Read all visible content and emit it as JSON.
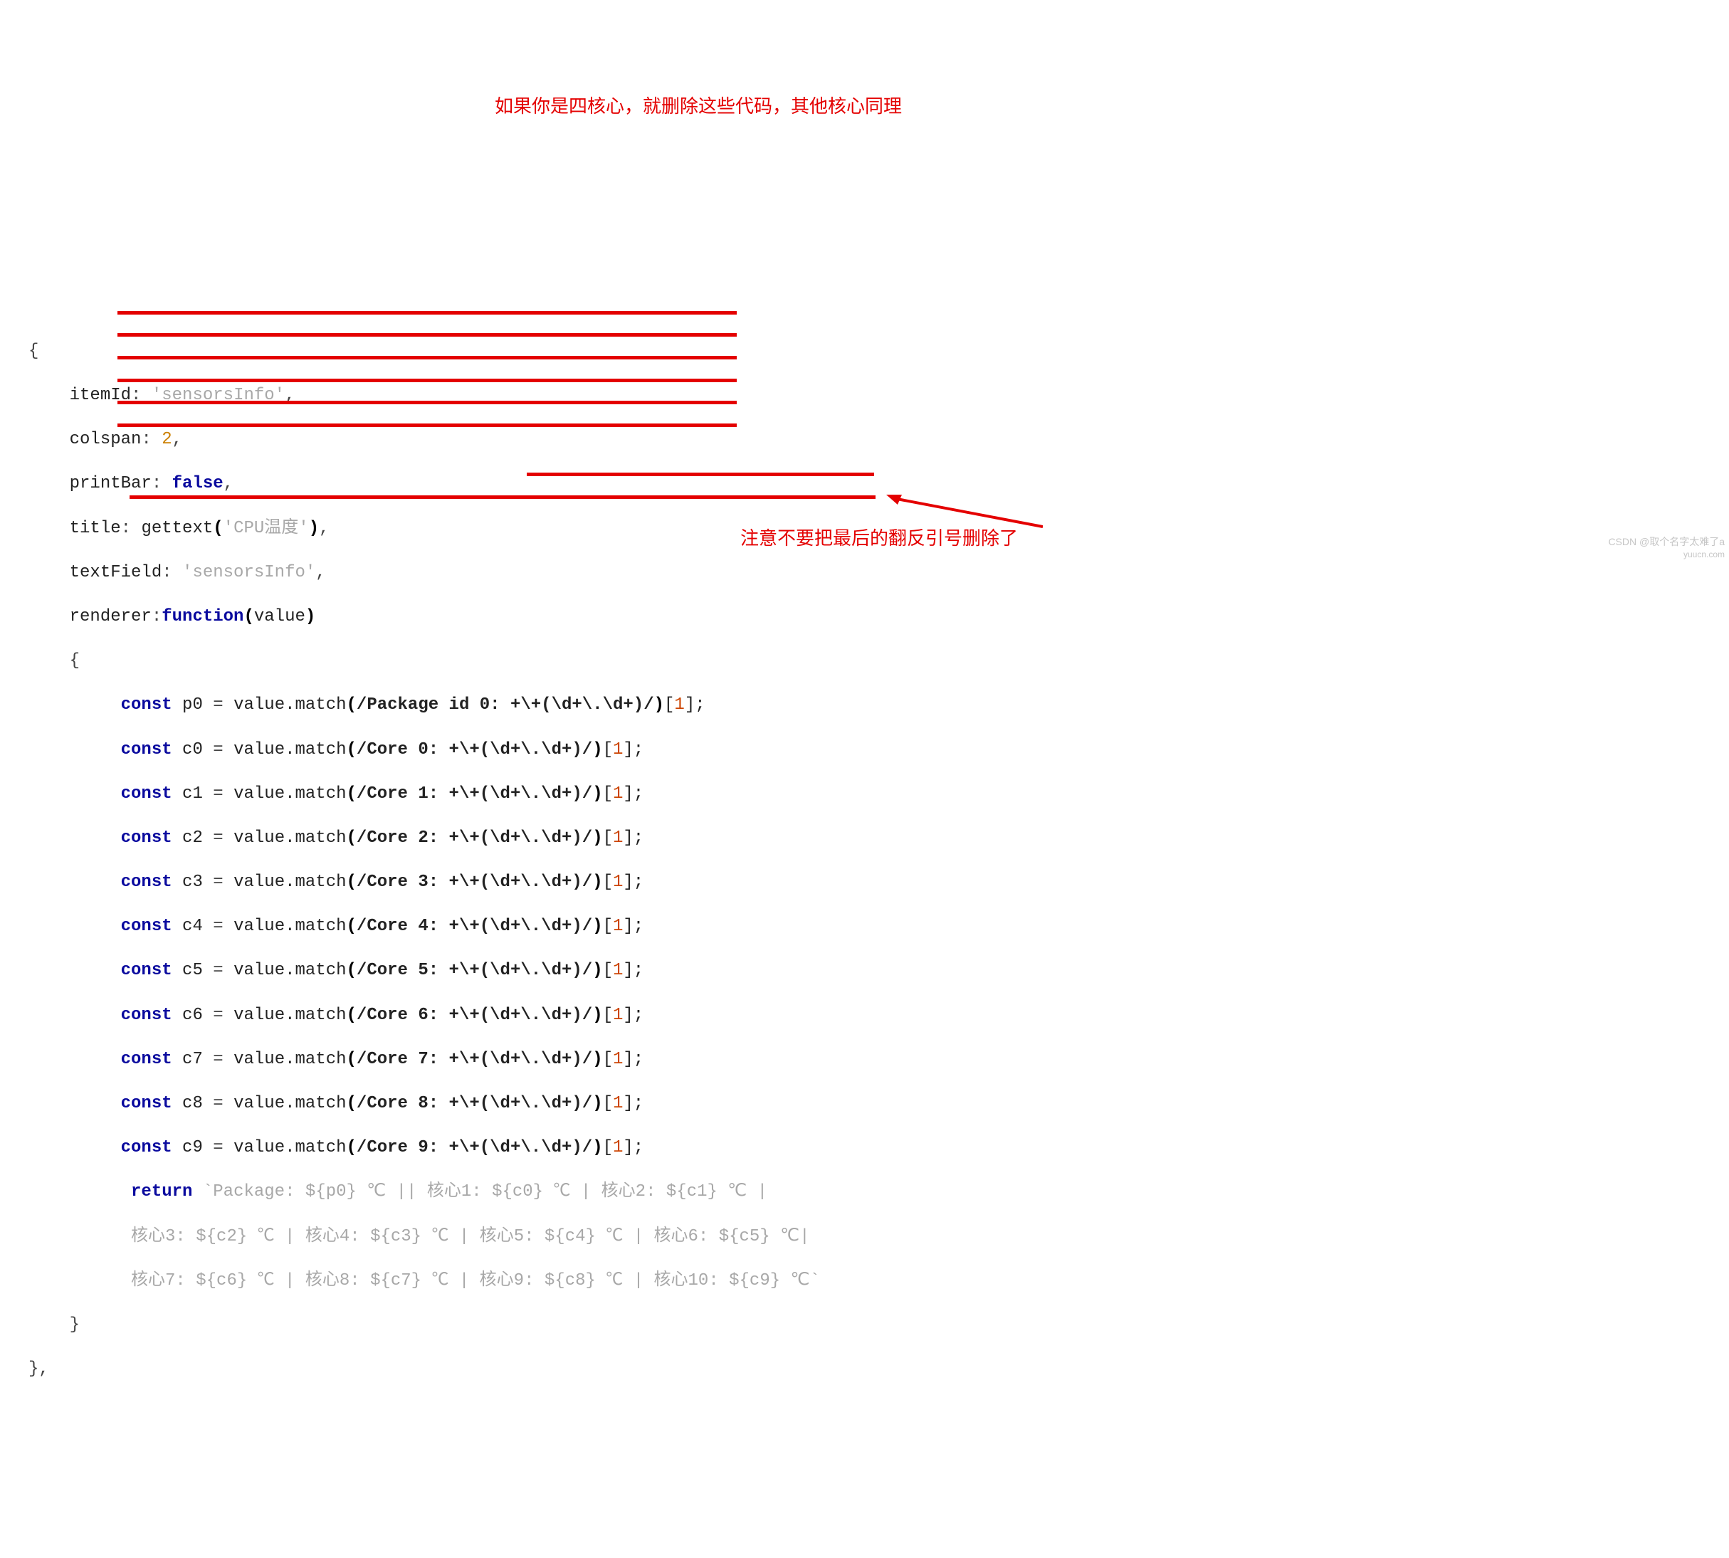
{
  "annotations": {
    "top": "如果你是四核心，就删除这些代码，其他核心同理",
    "bottom": "注意不要把最后的翻反引号删除了"
  },
  "watermarks": {
    "line1": "CSDN @取个名字太难了a",
    "line2": "yuucn.com"
  },
  "code": {
    "l1": "{",
    "l2_key": "itemId",
    "l2_val": "'sensorsInfo'",
    "l3_key": "colspan",
    "l3_val": "2",
    "l4_key": "printBar",
    "l4_val": "false",
    "l5_key": "title",
    "l5_call": "gettext",
    "l5_arg": "'CPU温度'",
    "l6_key": "textField",
    "l6_val": "'sensorsInfo'",
    "l7_key": "renderer",
    "l7_kw": "function",
    "l7_arg": "value",
    "l8": "{",
    "const": "const",
    "valmatch": "value.match",
    "p0_name": "p0",
    "p0_rx": "/Package id 0: +\\+(\\d+\\.\\d+)/",
    "c0_name": "c0",
    "c0_rx": "/Core 0: +\\+(\\d+\\.\\d+)/",
    "c1_name": "c1",
    "c1_rx": "/Core 1: +\\+(\\d+\\.\\d+)/",
    "c2_name": "c2",
    "c2_rx": "/Core 2: +\\+(\\d+\\.\\d+)/",
    "c3_name": "c3",
    "c3_rx": "/Core 3: +\\+(\\d+\\.\\d+)/",
    "c4_name": "c4",
    "c4_rx": "/Core 4: +\\+(\\d+\\.\\d+)/",
    "c5_name": "c5",
    "c5_rx": "/Core 5: +\\+(\\d+\\.\\d+)/",
    "c6_name": "c6",
    "c6_rx": "/Core 6: +\\+(\\d+\\.\\d+)/",
    "c7_name": "c7",
    "c7_rx": "/Core 7: +\\+(\\d+\\.\\d+)/",
    "c8_name": "c8",
    "c8_rx": "/Core 8: +\\+(\\d+\\.\\d+)/",
    "c9_name": "c9",
    "c9_rx": "/Core 9: +\\+(\\d+\\.\\d+)/",
    "idx": "1",
    "return_kw": "return",
    "ret_line1": "`Package: ${p0} ℃ || 核心1: ${c0} ℃ | 核心2: ${c1} ℃ | ",
    "ret_line2_keep": "核心3: ${c2} ℃ | 核心4: ${c3} ℃ ",
    "ret_line2_del": "| 核心5: ${c4} ℃ | 核心6: ${c5} ℃| ",
    "ret_line3": "核心7: ${c6} ℃ | 核心8: ${c7} ℃ | 核心9: ${c8} ℃ | 核心10: ${c9} ℃`",
    "close_brace": "}",
    "close_obj": "},"
  }
}
